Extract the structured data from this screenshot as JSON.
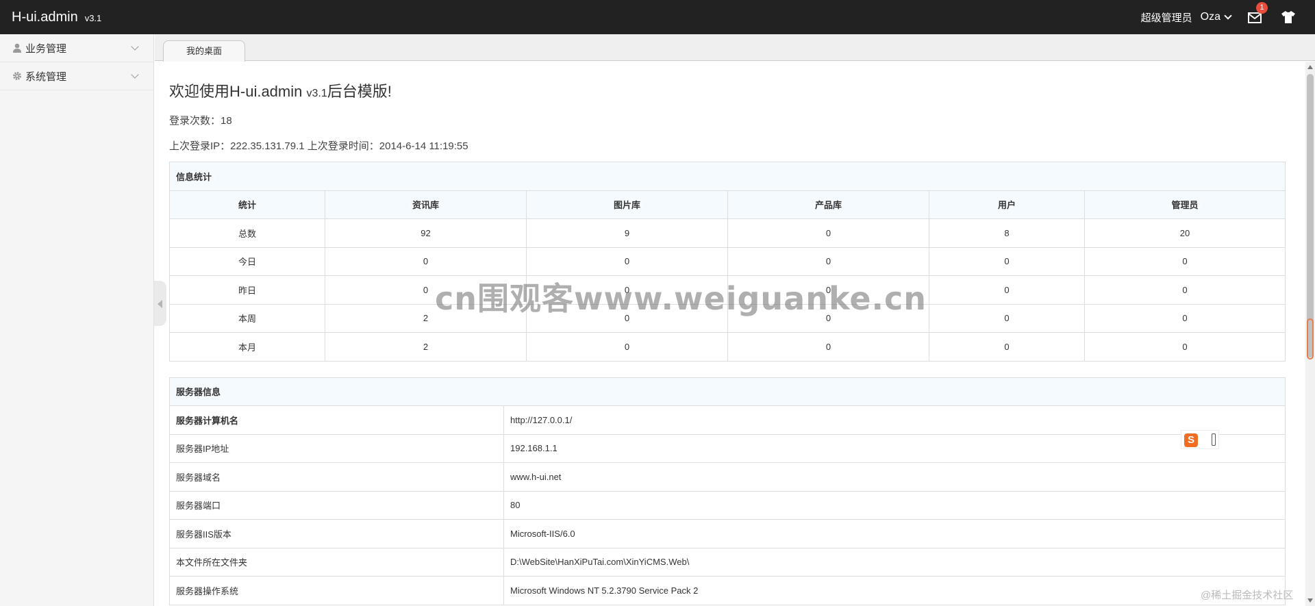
{
  "header": {
    "logo": "H-ui.admin",
    "version": "v3.1",
    "role": "超级管理员",
    "user": "Oza",
    "msg_count": "1"
  },
  "sidebar": {
    "items": [
      {
        "label": "业务管理",
        "icon": "user-icon"
      },
      {
        "label": "系统管理",
        "icon": "gear-icon"
      }
    ]
  },
  "tabs": [
    {
      "label": "我的桌面"
    }
  ],
  "main": {
    "welcome_prefix": "欢迎使用H-ui.admin ",
    "welcome_version": "v3.1",
    "welcome_suffix": "后台模版!",
    "login_count": "登录次数：18",
    "last_login": "上次登录IP：222.35.131.79.1 上次登录时间：2014-6-14 11:19:55"
  },
  "stats": {
    "title": "信息统计",
    "headers": [
      "统计",
      "资讯库",
      "图片库",
      "产品库",
      "用户",
      "管理员"
    ],
    "rows": [
      [
        "总数",
        "92",
        "9",
        "0",
        "8",
        "20"
      ],
      [
        "今日",
        "0",
        "0",
        "0",
        "0",
        "0"
      ],
      [
        "昨日",
        "0",
        "0",
        "0",
        "0",
        "0"
      ],
      [
        "本周",
        "2",
        "0",
        "0",
        "0",
        "0"
      ],
      [
        "本月",
        "2",
        "0",
        "0",
        "0",
        "0"
      ]
    ]
  },
  "server": {
    "title": "服务器信息",
    "rows": [
      [
        "服务器计算机名",
        "http://127.0.0.1/"
      ],
      [
        "服务器IP地址",
        "192.168.1.1"
      ],
      [
        "服务器域名",
        "www.h-ui.net"
      ],
      [
        "服务器端口",
        "80"
      ],
      [
        "服务器IIS版本",
        "Microsoft-IIS/6.0"
      ],
      [
        "本文件所在文件夹",
        "D:\\WebSite\\HanXiPuTai.com\\XinYiCMS.Web\\"
      ],
      [
        "服务器操作系统",
        "Microsoft Windows NT 5.2.3790 Service Pack 2"
      ]
    ]
  },
  "overlay": {
    "watermark": "cn围观客www.weiguanke.cn",
    "sogou": "S",
    "credit": "@稀土掘金技术社区"
  }
}
